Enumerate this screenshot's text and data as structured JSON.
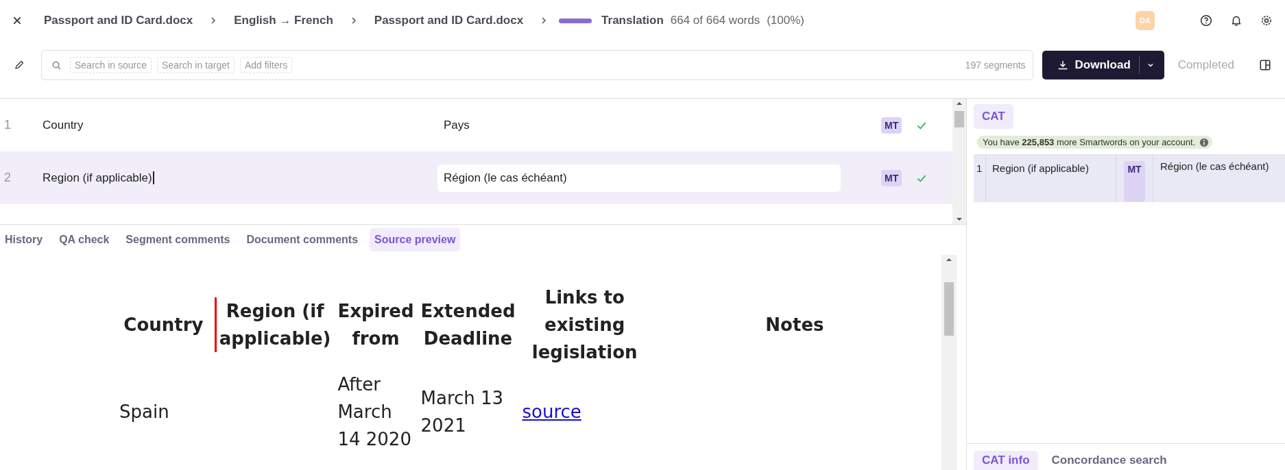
{
  "header": {
    "breadcrumbs": [
      "Passport and ID Card.docx",
      "English → French",
      "Passport and ID Card.docx"
    ],
    "progress": {
      "level": 1.0,
      "label": "Translation",
      "count": "664 of 664 words",
      "percent": "(100%)"
    },
    "avatar": "DA"
  },
  "toolbar": {
    "filters": [
      "Search in source",
      "Search in target",
      "Add filters"
    ],
    "segment_count": "197 segments",
    "download": "Download",
    "status": "Completed"
  },
  "segments": [
    {
      "number": "1",
      "source": "Country",
      "target": "Pays",
      "badge": "MT",
      "confirmed": true,
      "selected": false
    },
    {
      "number": "2",
      "source": "Region (if applicable)",
      "target": "Région (le cas échéant)",
      "badge": "MT",
      "confirmed": true,
      "selected": true
    }
  ],
  "bottom_tabs": [
    {
      "label": "History",
      "selected": false
    },
    {
      "label": "QA check",
      "selected": false
    },
    {
      "label": "Segment comments",
      "selected": false
    },
    {
      "label": "Document comments",
      "selected": false
    },
    {
      "label": "Source preview",
      "selected": true
    }
  ],
  "preview": {
    "columns": [
      {
        "label": "Country",
        "current": false
      },
      {
        "label": "Region (if applicable)",
        "current": true
      },
      {
        "label": "Expired from",
        "current": false
      },
      {
        "label": "Extended Deadline",
        "current": false
      },
      {
        "label": "Links to existing legislation",
        "current": false
      },
      {
        "label": "Notes",
        "current": false
      }
    ],
    "rows": [
      [
        {
          "kind": "text",
          "text": "Spain"
        },
        {
          "kind": "empty"
        },
        {
          "kind": "text",
          "text": "After March 14 2020"
        },
        {
          "kind": "text",
          "text": "March 13 2021"
        },
        {
          "kind": "link",
          "text": "source"
        },
        {
          "kind": "empty"
        }
      ]
    ]
  },
  "cat": {
    "tabs": [
      {
        "label": "CAT",
        "selected": true
      }
    ],
    "banner": "You have **225,853** more Smartwords on your account.",
    "results": [
      {
        "number": "1",
        "source": "Region (if applicable)",
        "badge": "MT",
        "target": "Région (le cas échéant)"
      }
    ],
    "bottom_tabs": [
      {
        "label": "CAT info",
        "selected": true
      },
      {
        "label": "Concordance search",
        "selected": false
      }
    ]
  }
}
